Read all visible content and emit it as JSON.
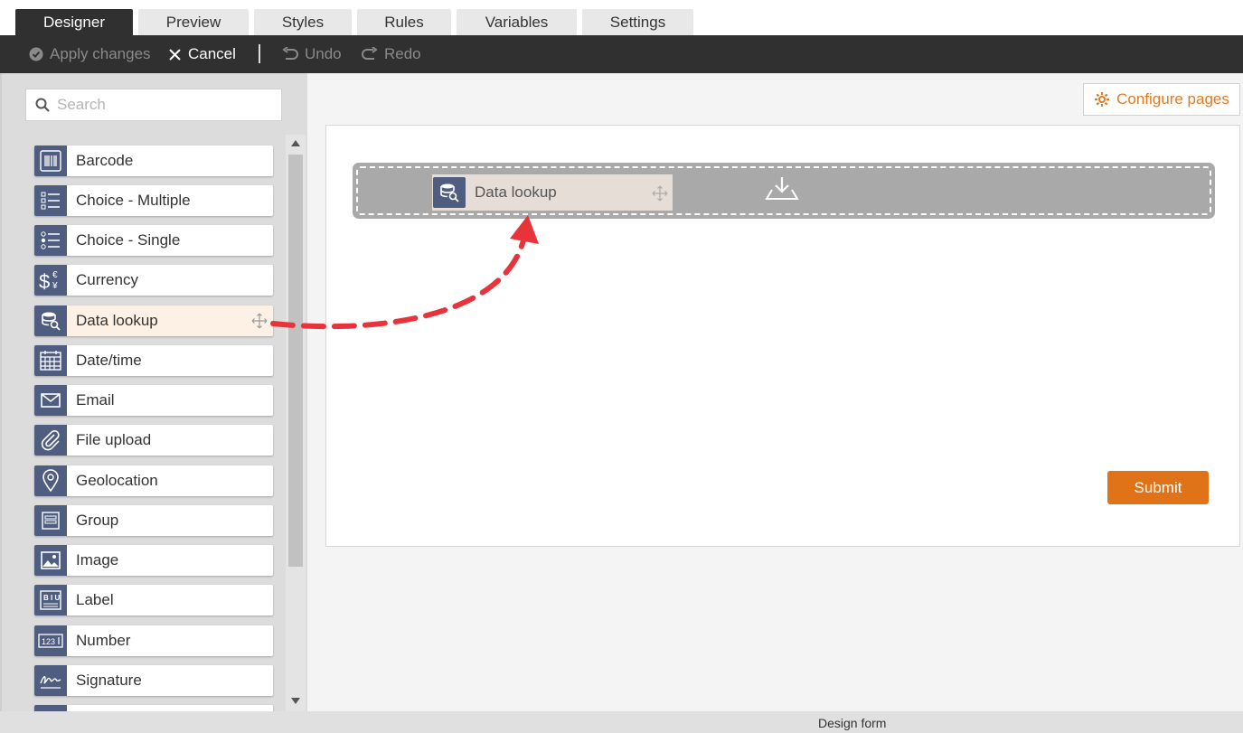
{
  "tabs": [
    "Designer",
    "Preview",
    "Styles",
    "Rules",
    "Variables",
    "Settings"
  ],
  "toolbar": {
    "apply": "Apply changes",
    "cancel": "Cancel",
    "undo": "Undo",
    "redo": "Redo"
  },
  "search": {
    "placeholder": "Search"
  },
  "palette": {
    "items": [
      {
        "label": "Barcode",
        "icon": "barcode-icon"
      },
      {
        "label": "Choice - Multiple",
        "icon": "checklist-icon"
      },
      {
        "label": "Choice - Single",
        "icon": "radio-list-icon"
      },
      {
        "label": "Currency",
        "icon": "currency-icon"
      },
      {
        "label": "Data lookup",
        "icon": "database-search-icon"
      },
      {
        "label": "Date/time",
        "icon": "calendar-icon"
      },
      {
        "label": "Email",
        "icon": "envelope-icon"
      },
      {
        "label": "File upload",
        "icon": "paperclip-icon"
      },
      {
        "label": "Geolocation",
        "icon": "map-pin-icon"
      },
      {
        "label": "Group",
        "icon": "group-icon"
      },
      {
        "label": "Image",
        "icon": "image-icon"
      },
      {
        "label": "Label",
        "icon": "label-icon"
      },
      {
        "label": "Number",
        "icon": "number-icon"
      },
      {
        "label": "Signature",
        "icon": "signature-icon"
      }
    ]
  },
  "canvas": {
    "configure_pages": "Configure pages",
    "dragging_label": "Data lookup",
    "submit": "Submit"
  },
  "status": {
    "text": "Design form"
  },
  "colors": {
    "accent": "#e07317",
    "icon_bg": "#4f5e80",
    "toolbar": "#303030"
  }
}
